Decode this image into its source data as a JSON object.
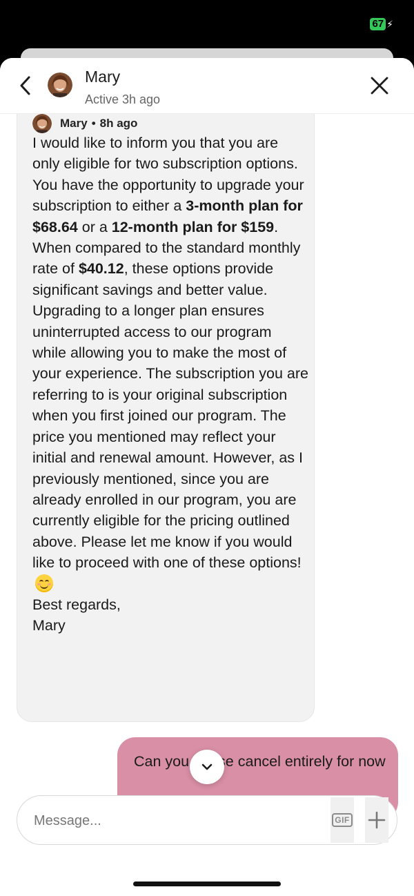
{
  "status_bar": {
    "battery_level": "67",
    "battery_color": "#34c759"
  },
  "header": {
    "contact_name": "Mary",
    "contact_status": "Active 3h ago",
    "back_icon": "chevron-left-icon",
    "close_icon": "close-icon"
  },
  "conversation": {
    "received_message": {
      "sender": "Mary",
      "separator": "•",
      "time": "8h ago",
      "segments": {
        "s1": "I would like to inform you that you are only eligible for two subscription options. You have the opportunity to upgrade your subscription to either a ",
        "b1": "3-month plan for $68.64",
        "s2": " or a ",
        "b2": "12-month plan for $159",
        "s3": ". When compared to the standard monthly rate of ",
        "b3": "$40.12",
        "s4": ", these options provide significant savings and better value. Upgrading to a longer plan ensures uninterrupted access to our program while allowing you to make the most of your experience. The subscription you are referring to is your original subscription when you first joined our program. The price you mentioned may reflect your initial and renewal amount. However, as I previously mentioned, since you are already enrolled in our program, you are currently eligible for the pricing outlined above. Please let me know if you would like to proceed with one of these options!",
        "emoji": "smiling-face-emoji",
        "s5": "Best regards,",
        "s6": "Mary"
      },
      "bubble_color": "#f2f2f2"
    },
    "sent_message": {
      "text_part1": "Can you",
      "text_part2": "ase cancel entirely for now",
      "bubble_color": "#d98fa6"
    },
    "scroll_down_icon": "chevron-down-icon"
  },
  "composer": {
    "placeholder": "Message...",
    "value": "",
    "gif_label": "GIF",
    "plus_icon": "plus-icon"
  }
}
